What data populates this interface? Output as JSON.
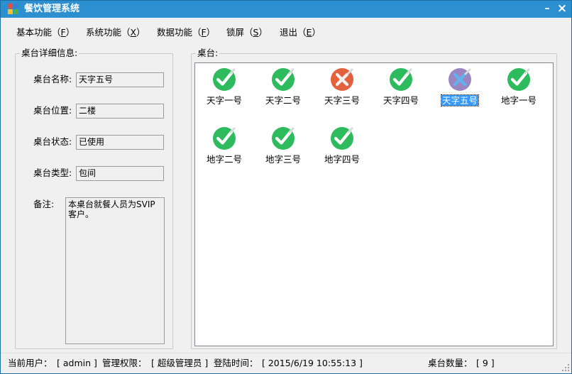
{
  "window": {
    "title": "餐饮管理系统",
    "minimize_glyph": "–",
    "close_glyph": "×"
  },
  "menu": {
    "items": [
      {
        "label": "基本功能",
        "open": "（",
        "key": "F",
        "close": "）"
      },
      {
        "label": "系统功能",
        "open": "（",
        "key": "X",
        "close": "）"
      },
      {
        "label": "数据功能",
        "open": "（",
        "key": "F",
        "close": "）"
      },
      {
        "label": "锁屏",
        "open": "（",
        "key": "S",
        "close": "）"
      },
      {
        "label": "退出",
        "open": "（",
        "key": "E",
        "close": "）"
      }
    ]
  },
  "details": {
    "legend": "桌台详细信息:",
    "name_label": "桌台名称:",
    "name_value": "天字五号",
    "location_label": "桌台位置:",
    "location_value": "二楼",
    "status_label": "桌台状态:",
    "status_value": "已使用",
    "type_label": "桌台类型:",
    "type_value": "包间",
    "notes_label": "备注:",
    "notes_value": "本桌台就餐人员为SVIP客户。"
  },
  "tables": {
    "legend": "桌台:",
    "items": [
      {
        "label": "天字一号",
        "status": "available",
        "icon": "check-icon",
        "color": "#2dbb5d",
        "selected": false
      },
      {
        "label": "天字二号",
        "status": "available",
        "icon": "check-icon",
        "color": "#2dbb5d",
        "selected": false
      },
      {
        "label": "天字三号",
        "status": "occupied",
        "icon": "cross-icon",
        "color": "#e4613d",
        "selected": false
      },
      {
        "label": "天字四号",
        "status": "available",
        "icon": "check-icon",
        "color": "#2dbb5d",
        "selected": false
      },
      {
        "label": "天字五号",
        "status": "occupied",
        "icon": "cross-icon",
        "color": "#9b86c2",
        "selected": true
      },
      {
        "label": "地字一号",
        "status": "available",
        "icon": "check-icon",
        "color": "#2dbb5d",
        "selected": false
      },
      {
        "label": "地字二号",
        "status": "available",
        "icon": "check-icon",
        "color": "#2dbb5d",
        "selected": false
      },
      {
        "label": "地字三号",
        "status": "available",
        "icon": "check-icon",
        "color": "#2dbb5d",
        "selected": false
      },
      {
        "label": "地字四号",
        "status": "available",
        "icon": "check-icon",
        "color": "#2dbb5d",
        "selected": false
      }
    ]
  },
  "statusbar": {
    "user_label": "当前用户：",
    "user_value": "[ admin ]",
    "role_label": "管理权限：",
    "role_value": "[ 超级管理员 ]",
    "login_label": "登陆时间：",
    "login_value": "[ 2015/6/19 10:55:13 ]",
    "count_label": "桌台数量：",
    "count_value": "[ 9 ]"
  },
  "colors": {
    "titlebar": "#2b8fd0",
    "available": "#2dbb5d",
    "occupied": "#e4613d",
    "selected_occupied": "#9b86c2",
    "selection": "#3399ff"
  }
}
